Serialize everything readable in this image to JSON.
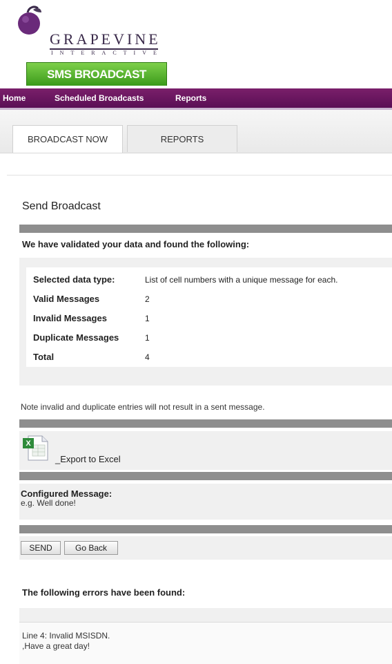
{
  "brand": {
    "logo_word": "GRAPEVINE",
    "logo_sub": "INTERACTIVE",
    "app_badge": "SMS BROADCAST"
  },
  "nav": {
    "items": [
      {
        "label": "Home"
      },
      {
        "label": "Scheduled Broadcasts"
      },
      {
        "label": "Reports"
      }
    ]
  },
  "tabs": [
    {
      "label": "BROADCAST NOW",
      "active": true
    },
    {
      "label": "REPORTS",
      "active": false
    }
  ],
  "page": {
    "title": "Send Broadcast",
    "validation_heading": "We have validated your data and found the following:"
  },
  "summary": {
    "rows": [
      {
        "label": "Selected data type:",
        "value": "List of cell numbers with a unique message for each."
      },
      {
        "label": "Valid Messages",
        "value": "2"
      },
      {
        "label": "Invalid Messages",
        "value": "1"
      },
      {
        "label": "Duplicate Messages",
        "value": "1"
      },
      {
        "label": "Total",
        "value": "4"
      }
    ]
  },
  "note": "Note invalid and duplicate entries will not result in a sent message.",
  "export": {
    "label": "_Export to Excel"
  },
  "message": {
    "heading": "Configured Message:",
    "text": "e.g. Well done!"
  },
  "actions": {
    "send_label": "SEND",
    "back_label": "Go Back"
  },
  "errors": {
    "heading": "The following errors have been found:",
    "line1": "Line 4: Invalid MSISDN.",
    "line2": ",Have a great day!"
  },
  "colors": {
    "nav_purple": "#6a1660",
    "badge_green": "#5cb832",
    "bar_gray": "#8e8e8e"
  }
}
